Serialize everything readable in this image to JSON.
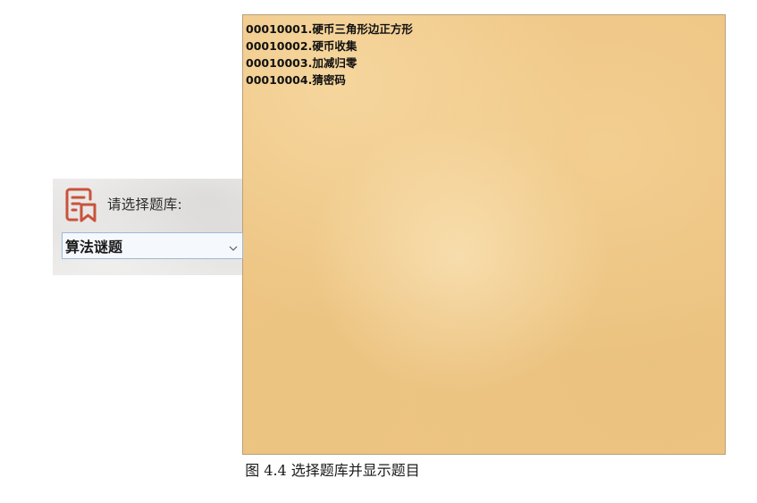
{
  "selector": {
    "label": "请选择题库:",
    "selected_value": "算法谜题",
    "icon": "question-bank-icon",
    "accent_color": "#c9533b"
  },
  "puzzle_list": {
    "items": [
      {
        "label": "00010001.硬币三角形边正方形"
      },
      {
        "label": "00010002.硬币收集"
      },
      {
        "label": "00010003.加减归零"
      },
      {
        "label": "00010004.猜密码"
      }
    ],
    "background_color": "#eec483"
  },
  "caption": "图 4.4  选择题库并显示题目"
}
